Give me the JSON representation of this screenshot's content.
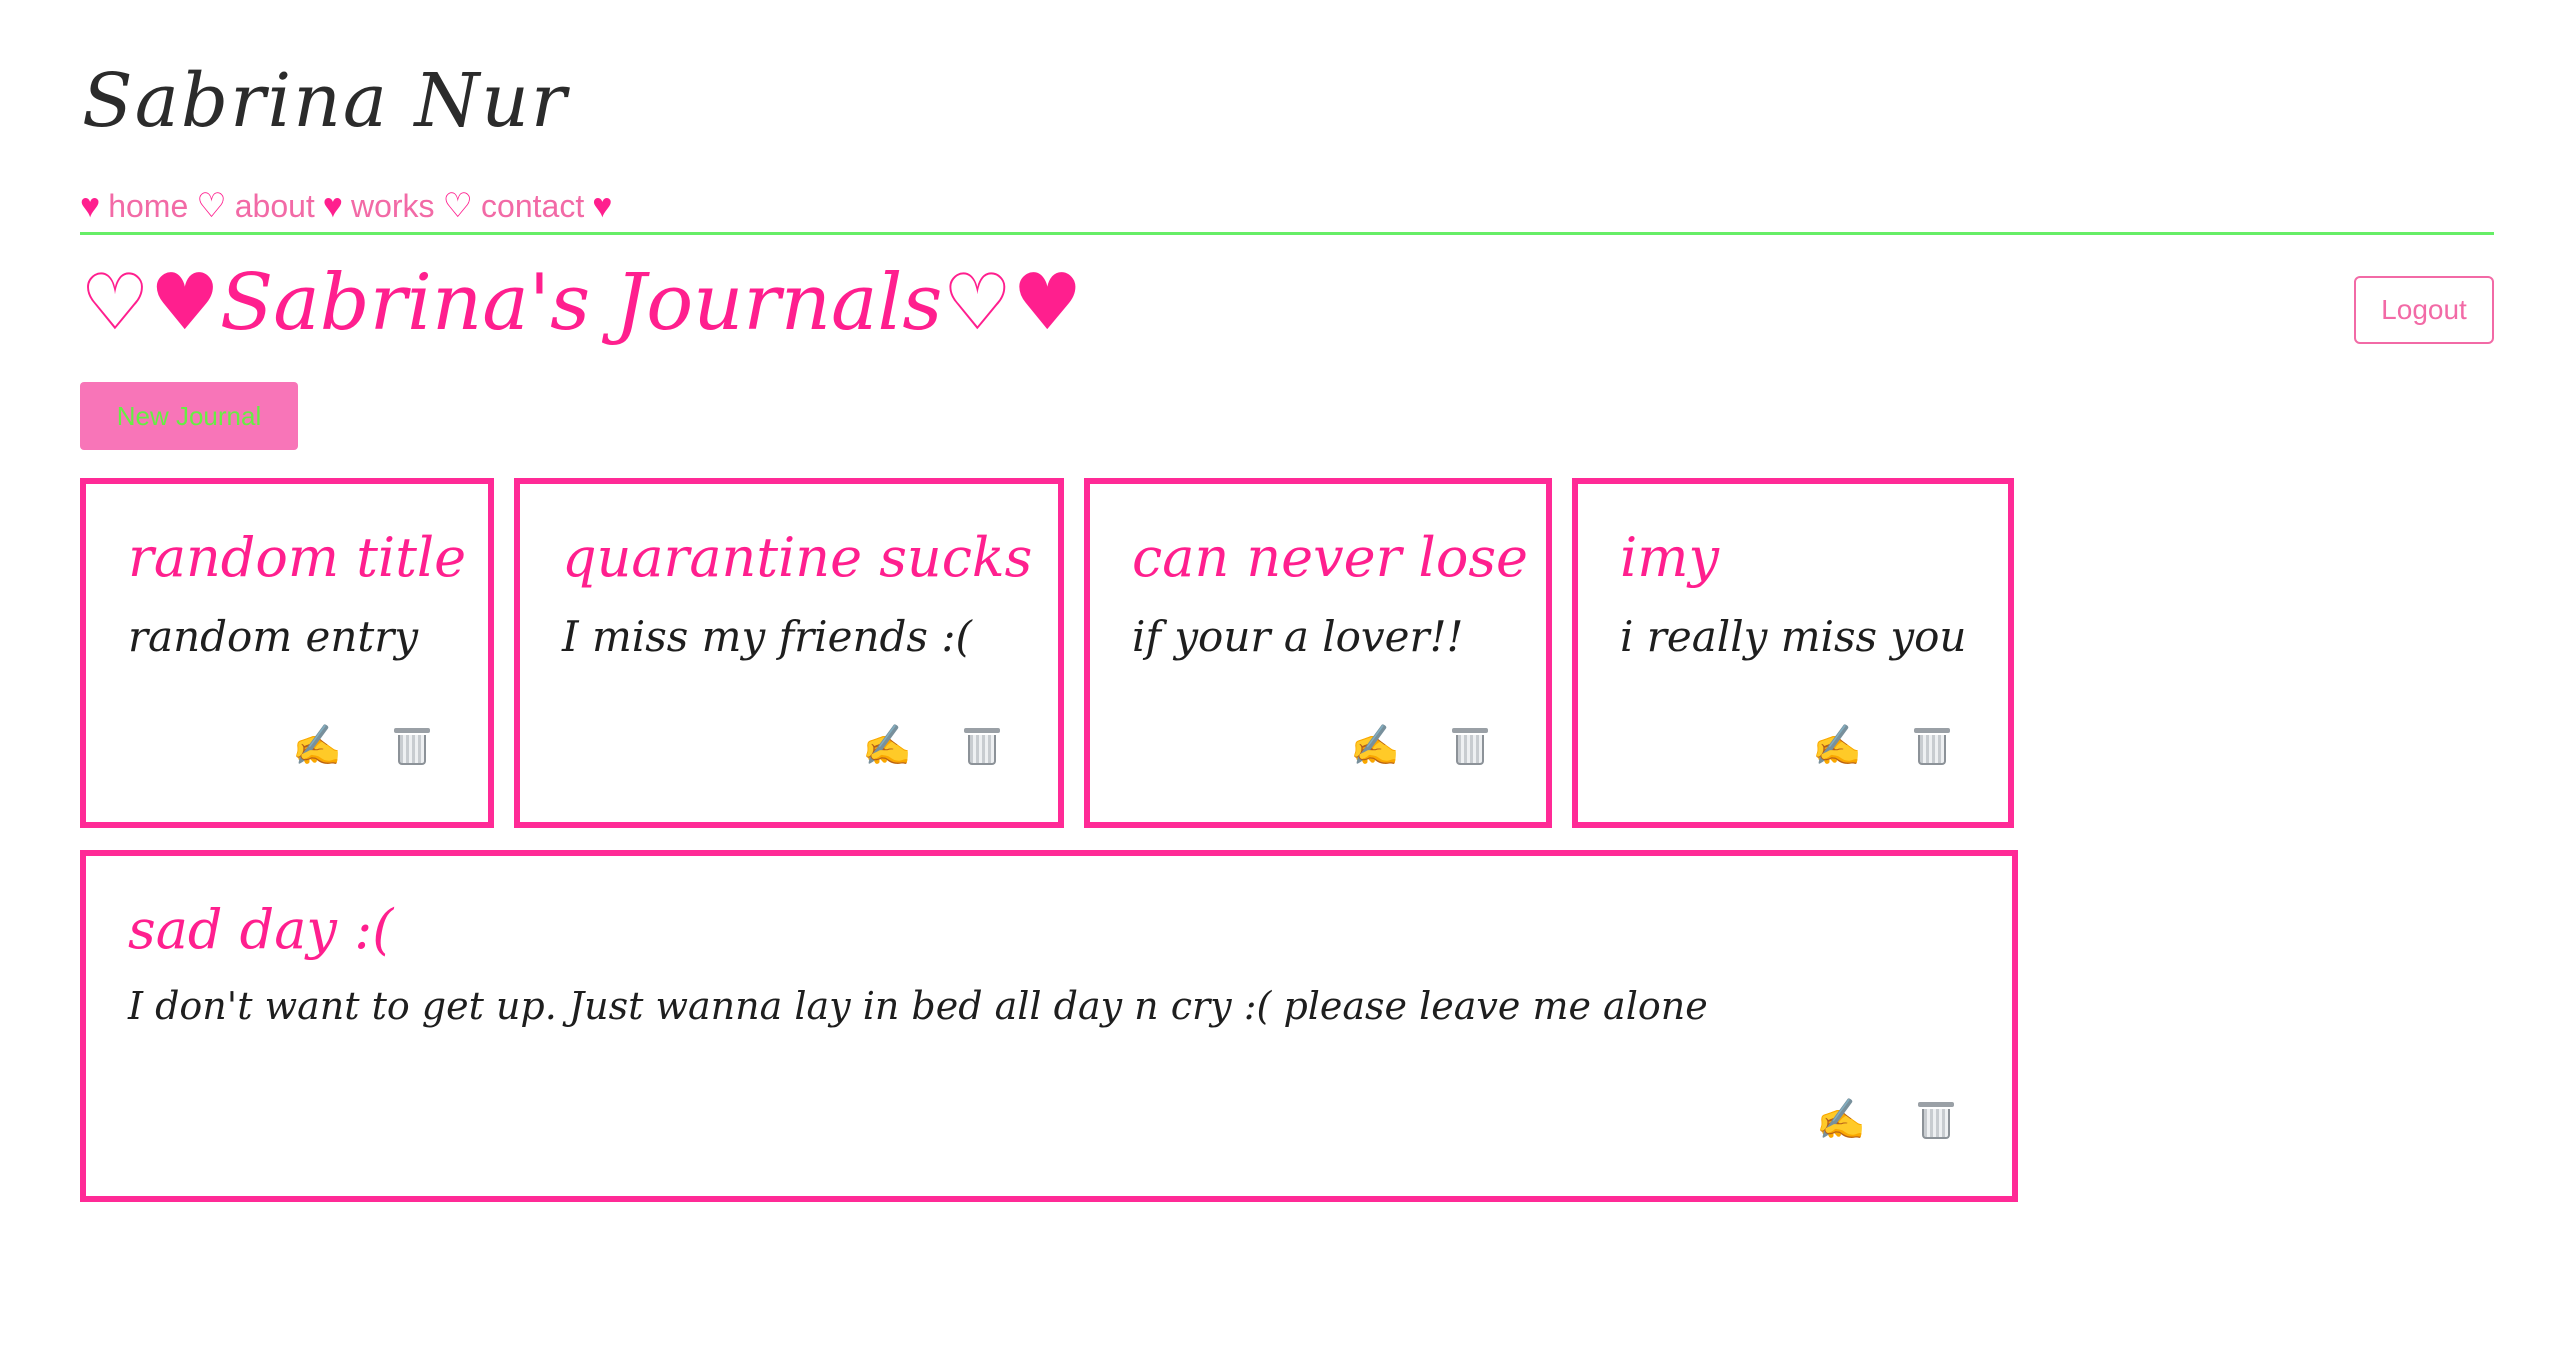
{
  "header": {
    "site_name": "Sabrina Nur"
  },
  "nav": {
    "items": [
      {
        "label": "home",
        "heart_before": "♥"
      },
      {
        "label": "about",
        "heart_before": "♡"
      },
      {
        "label": "works",
        "heart_before": "♥"
      },
      {
        "label": "contact",
        "heart_before": "♡"
      }
    ],
    "trailing_heart": "♥"
  },
  "main": {
    "title": "♡♥Sabrina's Journals♡♥",
    "logout_label": "Logout",
    "new_journal_label": "New Journal"
  },
  "journals": [
    {
      "title": "random title",
      "entry": "random entry"
    },
    {
      "title": "quarantine sucks",
      "entry": "I miss my friends :("
    },
    {
      "title": "can never lose",
      "entry": "if your a lover!!"
    },
    {
      "title": "imy",
      "entry": "i really miss you"
    },
    {
      "title": "sad day :(",
      "entry": "I don't want to get up. Just wanna lay in bed all day n cry :( please leave me alone"
    }
  ],
  "icons": {
    "edit": "writing-hand-icon",
    "delete": "wastebasket-icon"
  },
  "colors": {
    "accent_pink": "#ff1f8e",
    "soft_pink": "#f26aa6",
    "button_pink": "#f875b8",
    "divider_green": "#66ee66",
    "button_text_green": "#66ee44"
  }
}
